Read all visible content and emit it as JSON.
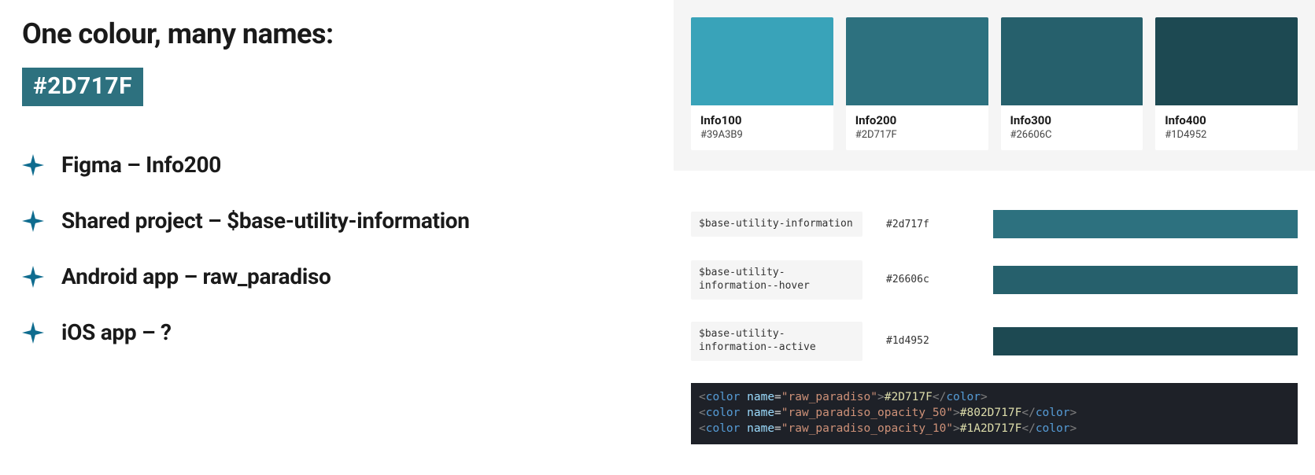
{
  "title": "One colour, many names:",
  "badge_hex": "#2D717F",
  "badge_bg": "#2D717F",
  "bullets": [
    "Figma – Info200",
    "Shared project – $base-utility-information",
    "Android app – raw_paradiso",
    "iOS app – ?"
  ],
  "sparkle_color": "#0F6C8F",
  "palette": [
    {
      "name": "Info100",
      "hex": "#39A3B9",
      "color": "#39A3B9"
    },
    {
      "name": "Info200",
      "hex": "#2D717F",
      "color": "#2D717F"
    },
    {
      "name": "Info300",
      "hex": "#26606C",
      "color": "#26606C"
    },
    {
      "name": "Info400",
      "hex": "#1D4952",
      "color": "#1D4952"
    }
  ],
  "tokens": [
    {
      "name": "$base-utility-information",
      "hex": "#2d717f",
      "color": "#2D717F"
    },
    {
      "name": "$base-utility-information--hover",
      "hex": "#26606c",
      "color": "#26606C"
    },
    {
      "name": "$base-utility-information--active",
      "hex": "#1d4952",
      "color": "#1D4952"
    }
  ],
  "code_lines": [
    {
      "name": "raw_paradiso",
      "value": "#2D717F"
    },
    {
      "name": "raw_paradiso_opacity_50",
      "value": "#802D717F"
    },
    {
      "name": "raw_paradiso_opacity_10",
      "value": "#1A2D717F"
    }
  ]
}
